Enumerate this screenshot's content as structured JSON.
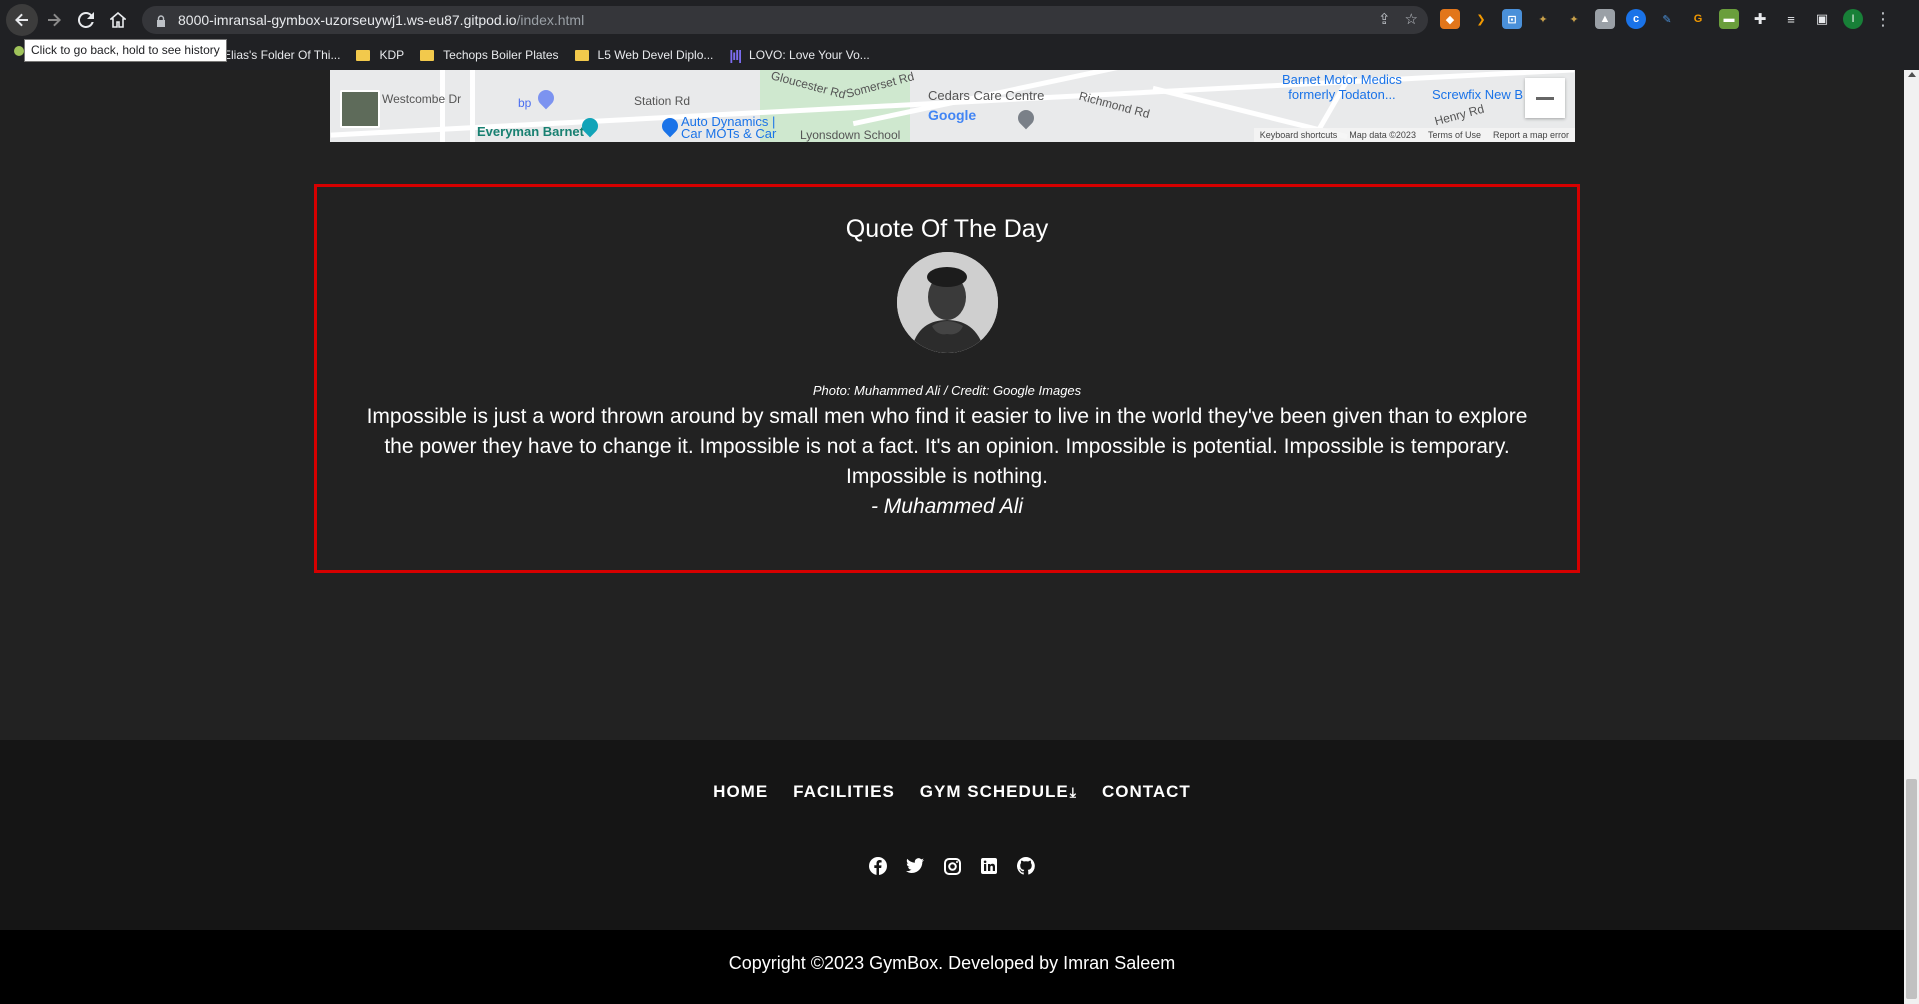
{
  "browser": {
    "url_host": "8000-imransal-gymbox-uzorseuywj1.ws-eu87.gitpod.io",
    "url_path": "/index.html",
    "tooltip": "Click to go back, hold to see history",
    "profile_initial": "I",
    "bookmarks": [
      {
        "label": "Elias's Folder Of Thi..."
      },
      {
        "label": "KDP"
      },
      {
        "label": "Techops Boiler Plates"
      },
      {
        "label": "L5 Web Devel Diplo..."
      },
      {
        "label": "LOVO: Love Your Vo..."
      }
    ]
  },
  "map": {
    "labels": {
      "westcombe": "Westcombe Dr",
      "station": "Station Rd",
      "gloucester": "Gloucester Rd",
      "somerset": "Somerset Rd",
      "cedars": "Cedars Care Centre",
      "richmond": "Richmond Rd",
      "barnet_motor": "Barnet Motor Medics",
      "barnet_motor_2": "formerly Todaton...",
      "screwfix": "Screwfix New B",
      "everyman": "Everyman Barnet",
      "auto_dynamics": "Auto Dynamics |",
      "auto_dynamics_2": "Car MOTs & Car",
      "lyonsdown": "Lyonsdown School",
      "henry": "Henry Rd",
      "bp": "bp",
      "google": "Google"
    },
    "footer": {
      "shortcuts": "Keyboard shortcuts",
      "map_data": "Map data ©2023",
      "terms": "Terms of Use",
      "report": "Report a map error"
    }
  },
  "quote": {
    "title": "Quote Of The Day",
    "photo_credit": "Photo: Muhammed Ali / Credit: Google Images",
    "text": "Impossible is just a word thrown around by small men who find it easier to live in the world they've been given than to explore the power they have to change it. Impossible is not a fact. It's an opinion. Impossible is potential. Impossible is temporary. Impossible is nothing.",
    "author": "- Muhammed Ali"
  },
  "footer": {
    "nav": {
      "home": "HOME",
      "facilities": "FACILITIES",
      "gym_schedule": "GYM SCHEDULE",
      "contact": "CONTACT"
    },
    "social_icons": [
      "facebook-icon",
      "twitter-icon",
      "instagram-icon",
      "linkedin-icon",
      "github-icon"
    ],
    "copyright": "Copyright ©2023 GymBox. Developed by Imran Saleem"
  },
  "colors": {
    "page_bg": "#222222",
    "quote_border": "#d60000",
    "footer_bg": "#151515",
    "copyright_bg": "#000000"
  }
}
